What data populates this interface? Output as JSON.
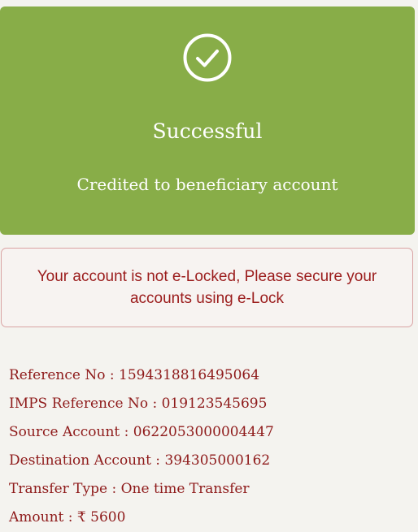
{
  "status": {
    "icon": "check-circle-icon",
    "title": "Successful",
    "subtitle": "Credited to beneficiary account",
    "color": "#88ad48"
  },
  "alert": {
    "message": "Your account is not e-Locked, Please secure your accounts using e-Lock",
    "text_color": "#9b1c1c",
    "border_color": "#d9a3a3"
  },
  "details": [
    {
      "label": "Reference No",
      "value": "1594318816495064"
    },
    {
      "label": "IMPS Reference No",
      "value": "019123545695"
    },
    {
      "label": "Source Account",
      "value": "0622053000004447"
    },
    {
      "label": "Destination Account",
      "value": "394305000162"
    },
    {
      "label": "Transfer Type",
      "value": "One time Transfer"
    },
    {
      "label": "Amount",
      "value": "₹ 5600"
    }
  ]
}
